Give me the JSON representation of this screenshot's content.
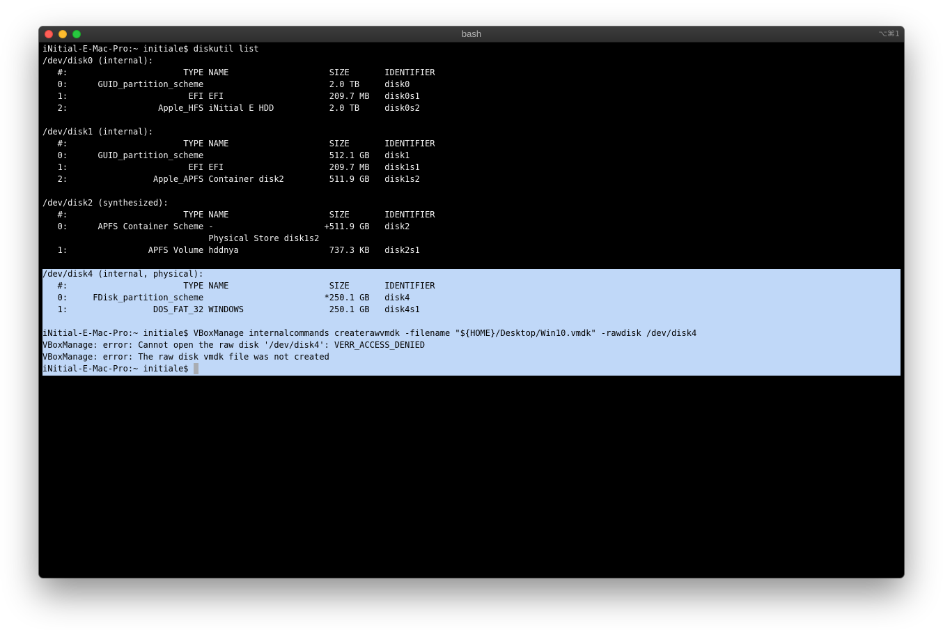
{
  "window": {
    "title": "bash",
    "shortcut": "⌥⌘1"
  },
  "terminal": {
    "lines": [
      "iNitial-E-Mac-Pro:~ initiale$ diskutil list",
      "/dev/disk0 (internal):",
      "   #:                       TYPE NAME                    SIZE       IDENTIFIER",
      "   0:      GUID_partition_scheme                         2.0 TB     disk0",
      "   1:                        EFI EFI                     209.7 MB   disk0s1",
      "   2:                  Apple_HFS iNitial E HDD           2.0 TB     disk0s2",
      "",
      "/dev/disk1 (internal):",
      "   #:                       TYPE NAME                    SIZE       IDENTIFIER",
      "   0:      GUID_partition_scheme                         512.1 GB   disk1",
      "   1:                        EFI EFI                     209.7 MB   disk1s1",
      "   2:                 Apple_APFS Container disk2         511.9 GB   disk1s2",
      "",
      "/dev/disk2 (synthesized):",
      "   #:                       TYPE NAME                    SIZE       IDENTIFIER",
      "   0:      APFS Container Scheme -                      +511.9 GB   disk2",
      "                                 Physical Store disk1s2",
      "   1:                APFS Volume hddnya                  737.3 KB   disk2s1",
      "",
      "/dev/disk4 (internal, physical):",
      "   #:                       TYPE NAME                    SIZE       IDENTIFIER",
      "   0:     FDisk_partition_scheme                        *250.1 GB   disk4",
      "   1:                 DOS_FAT_32 WINDOWS                 250.1 GB   disk4s1",
      "",
      "iNitial-E-Mac-Pro:~ initiale$ VBoxManage internalcommands createrawvmdk -filename \"${HOME}/Desktop/Win10.vmdk\" -rawdisk /dev/disk4",
      "VBoxManage: error: Cannot open the raw disk '/dev/disk4': VERR_ACCESS_DENIED",
      "VBoxManage: error: The raw disk vmdk file was not created",
      "iNitial-E-Mac-Pro:~ initiale$ "
    ]
  },
  "colors": {
    "background": "#000000",
    "text": "#f2f2f2",
    "selection": "#c0d8f8",
    "selected_text": "#000000",
    "cursor": "#a9adb3"
  }
}
